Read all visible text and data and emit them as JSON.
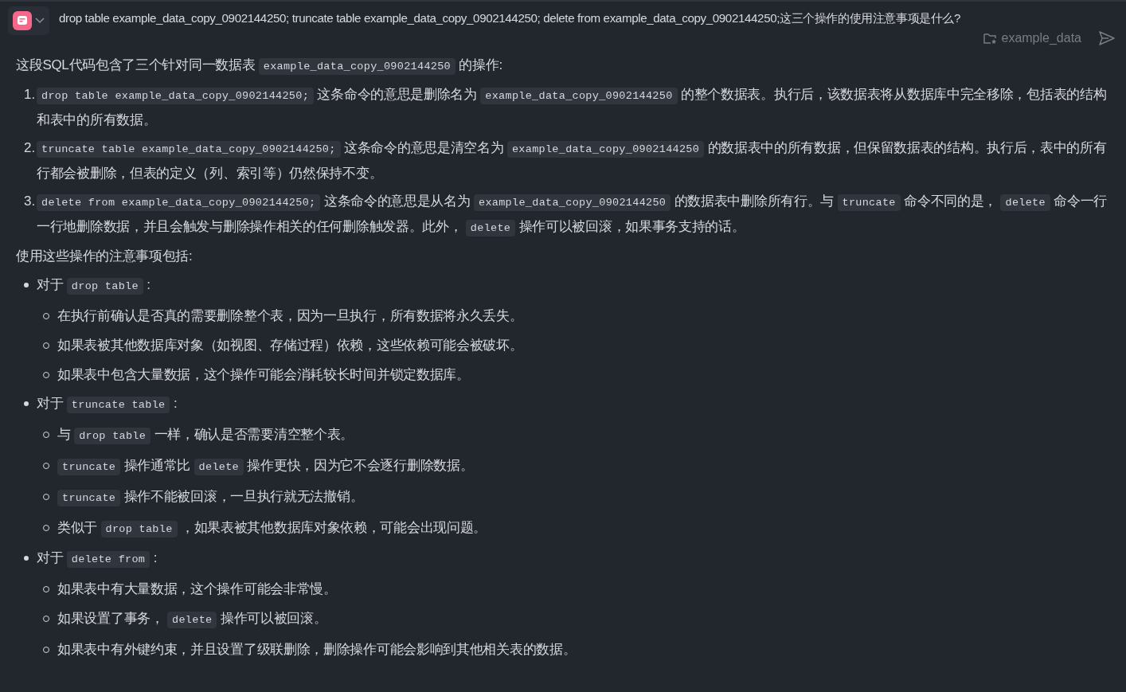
{
  "question": {
    "text": "drop table example_data_copy_0902144250; truncate table example_data_copy_0902144250; delete from example_data_copy_0902144250;这三个操作的使用注意事项是什么?"
  },
  "dataset_tag": {
    "label": "example_data"
  },
  "answer": {
    "intro": [
      {
        "kind": "text",
        "text": "这段SQL代码包含了三个针对同一数据表 "
      },
      {
        "kind": "code",
        "text": "example_data_copy_0902144250"
      },
      {
        "kind": "text",
        "text": " 的操作:"
      }
    ],
    "steps": [
      {
        "number": "1.",
        "segments": [
          {
            "kind": "code",
            "text": "drop table example_data_copy_0902144250;"
          },
          {
            "kind": "text",
            "text": " 这条命令的意思是删除名为 "
          },
          {
            "kind": "code",
            "text": "example_data_copy_0902144250"
          },
          {
            "kind": "text",
            "text": " 的整个数据表。执行后，该数据表将从数据库中完全移除，包括表的结构和表中的所有数据。"
          }
        ]
      },
      {
        "number": "2.",
        "segments": [
          {
            "kind": "code",
            "text": "truncate table example_data_copy_0902144250;"
          },
          {
            "kind": "text",
            "text": " 这条命令的意思是清空名为 "
          },
          {
            "kind": "code",
            "text": "example_data_copy_0902144250"
          },
          {
            "kind": "text",
            "text": " 的数据表中的所有数据，但保留数据表的结构。执行后，表中的所有行都会被删除，但表的定义（列、索引等）仍然保持不变。"
          }
        ]
      },
      {
        "number": "3.",
        "segments": [
          {
            "kind": "code",
            "text": "delete from example_data_copy_0902144250;"
          },
          {
            "kind": "text",
            "text": " 这条命令的意思是从名为 "
          },
          {
            "kind": "code",
            "text": "example_data_copy_0902144250"
          },
          {
            "kind": "text",
            "text": " 的数据表中删除所有行。与 "
          },
          {
            "kind": "code",
            "text": "truncate"
          },
          {
            "kind": "text",
            "text": " 命令不同的是， "
          },
          {
            "kind": "code",
            "text": "delete"
          },
          {
            "kind": "text",
            "text": " 命令一行一行地删除数据，并且会触发与删除操作相关的任何删除触发器。此外， "
          },
          {
            "kind": "code",
            "text": "delete"
          },
          {
            "kind": "text",
            "text": " 操作可以被回滚，如果事务支持的话。"
          }
        ]
      }
    ],
    "notes_heading": "使用这些操作的注意事项包括:",
    "notes": [
      {
        "segments": [
          {
            "kind": "text",
            "text": "对于 "
          },
          {
            "kind": "code",
            "text": "drop table"
          },
          {
            "kind": "text",
            "text": " :"
          }
        ],
        "children": [
          {
            "segments": [
              {
                "kind": "text",
                "text": "在执行前确认是否真的需要删除整个表，因为一旦执行，所有数据将永久丢失。"
              }
            ]
          },
          {
            "segments": [
              {
                "kind": "text",
                "text": "如果表被其他数据库对象（如视图、存储过程）依赖，这些依赖可能会被破坏。"
              }
            ]
          },
          {
            "segments": [
              {
                "kind": "text",
                "text": "如果表中包含大量数据，这个操作可能会消耗较长时间并锁定数据库。"
              }
            ]
          }
        ]
      },
      {
        "segments": [
          {
            "kind": "text",
            "text": "对于 "
          },
          {
            "kind": "code",
            "text": "truncate table"
          },
          {
            "kind": "text",
            "text": " :"
          }
        ],
        "children": [
          {
            "segments": [
              {
                "kind": "text",
                "text": "与 "
              },
              {
                "kind": "code",
                "text": "drop table"
              },
              {
                "kind": "text",
                "text": " 一样，确认是否需要清空整个表。"
              }
            ]
          },
          {
            "segments": [
              {
                "kind": "code",
                "text": "truncate"
              },
              {
                "kind": "text",
                "text": " 操作通常比 "
              },
              {
                "kind": "code",
                "text": "delete"
              },
              {
                "kind": "text",
                "text": " 操作更快，因为它不会逐行删除数据。"
              }
            ]
          },
          {
            "segments": [
              {
                "kind": "code",
                "text": "truncate"
              },
              {
                "kind": "text",
                "text": " 操作不能被回滚，一旦执行就无法撤销。"
              }
            ]
          },
          {
            "segments": [
              {
                "kind": "text",
                "text": "类似于 "
              },
              {
                "kind": "code",
                "text": "drop table"
              },
              {
                "kind": "text",
                "text": " ，如果表被其他数据库对象依赖，可能会出现问题。"
              }
            ]
          }
        ]
      },
      {
        "segments": [
          {
            "kind": "text",
            "text": "对于 "
          },
          {
            "kind": "code",
            "text": "delete from"
          },
          {
            "kind": "text",
            "text": " :"
          }
        ],
        "children": [
          {
            "segments": [
              {
                "kind": "text",
                "text": "如果表中有大量数据，这个操作可能会非常慢。"
              }
            ]
          },
          {
            "segments": [
              {
                "kind": "text",
                "text": "如果设置了事务， "
              },
              {
                "kind": "code",
                "text": "delete"
              },
              {
                "kind": "text",
                "text": " 操作可以被回滚。"
              }
            ]
          },
          {
            "segments": [
              {
                "kind": "text",
                "text": "如果表中有外键约束，并且设置了级联删除，删除操作可能会影响到其他相关表的数据。"
              }
            ]
          }
        ]
      }
    ]
  }
}
